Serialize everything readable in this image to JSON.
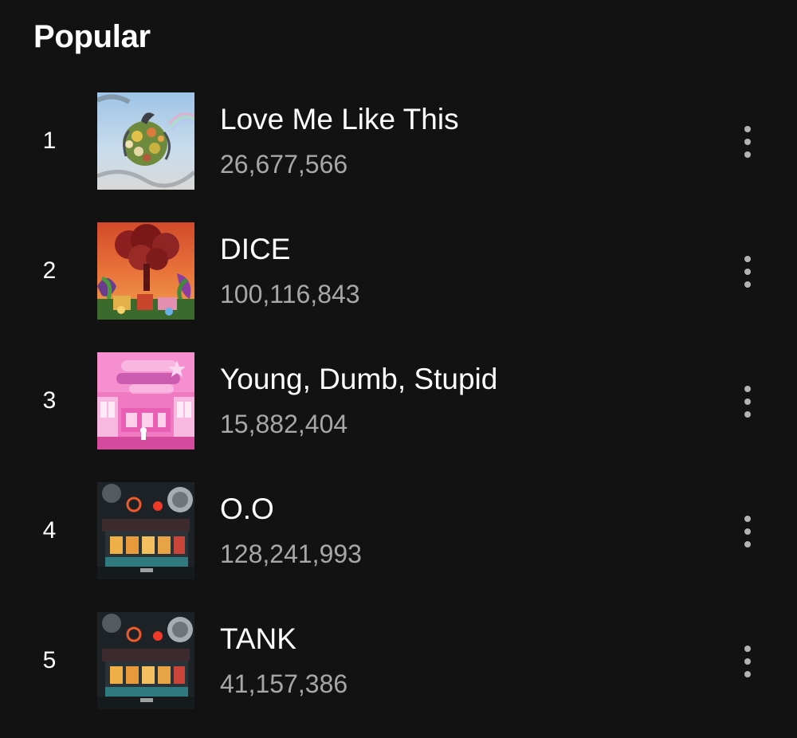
{
  "section": {
    "title": "Popular"
  },
  "tracks": [
    {
      "rank": "1",
      "title": "Love Me Like This",
      "plays": "26,677,566",
      "cover_icon": "floral-sphere-album-art"
    },
    {
      "rank": "2",
      "title": "DICE",
      "plays": "100,116,843",
      "cover_icon": "red-smoke-album-art"
    },
    {
      "rank": "3",
      "title": "Young, Dumb, Stupid",
      "plays": "15,882,404",
      "cover_icon": "pink-room-album-art"
    },
    {
      "rank": "4",
      "title": "O.O",
      "plays": "128,241,993",
      "cover_icon": "night-storefront-album-art"
    },
    {
      "rank": "5",
      "title": "TANK",
      "plays": "41,157,386",
      "cover_icon": "night-storefront-album-art"
    }
  ],
  "more_icon": "more-vertical-icon",
  "colors": {
    "background": "#121212",
    "title_text": "#ffffff",
    "secondary_text": "#a7a7a7",
    "icon": "#b3b3b3"
  }
}
